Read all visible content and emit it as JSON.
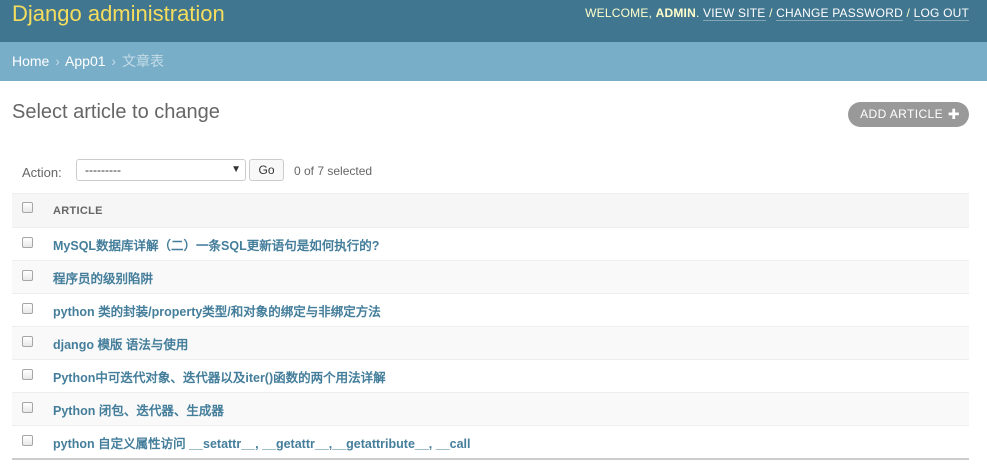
{
  "header": {
    "brand": "Django administration",
    "welcome": "WELCOME,",
    "username": "ADMIN",
    "view_site": "VIEW SITE",
    "change_password": "CHANGE PASSWORD",
    "log_out": "LOG OUT",
    "separator": "/"
  },
  "breadcrumbs": {
    "home": "Home",
    "app": "App01",
    "current": "文章表",
    "arrow": "›"
  },
  "page": {
    "title": "Select article to change",
    "add_button": "ADD ARTICLE",
    "add_icon": "plus-icon"
  },
  "actions": {
    "label": "Action:",
    "selected_option": "---------",
    "go": "Go",
    "counter": "0 of 7 selected"
  },
  "table": {
    "header": "ARTICLE",
    "rows": [
      "MySQL数据库详解（二）一条SQL更新语句是如何执行的?",
      "程序员的级别陷阱",
      "python 类的封装/property类型/和对象的绑定与非绑定方法",
      "django 模版 语法与使用",
      "Python中可迭代对象、迭代器以及iter()函数的两个用法详解",
      "Python 闭包、迭代器、生成器",
      "python 自定义属性访问 __setattr__, __getattr__,__getattribute__, __call"
    ]
  },
  "colors": {
    "header_bg": "#417690",
    "brand": "#f5dd5d",
    "breadcrumb_bg": "#79aec8",
    "link": "#447e9b",
    "add_button_bg": "#999999"
  }
}
